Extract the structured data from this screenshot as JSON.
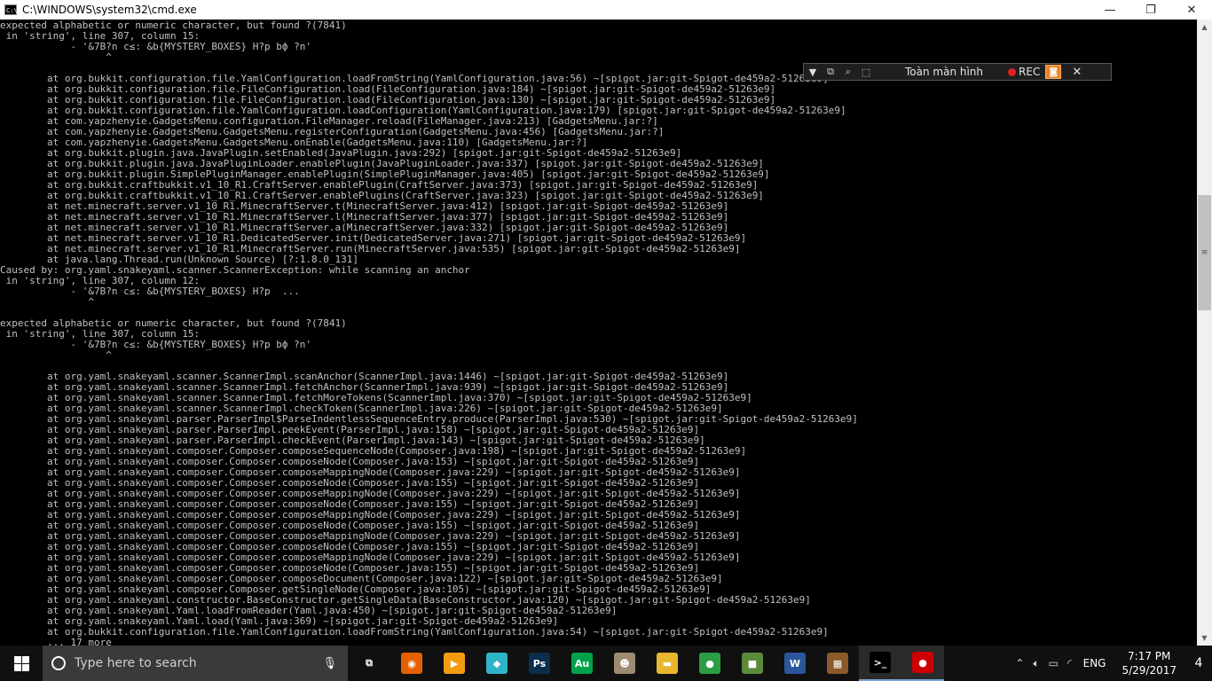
{
  "window": {
    "title": "C:\\WINDOWS\\system32\\cmd.exe",
    "icon": "cmd-icon",
    "controls": {
      "minimize": "—",
      "maximize": "❐",
      "close": "✕"
    }
  },
  "console": {
    "lines": [
      "expected alphabetic or numeric character, but found ?(7841)",
      " in 'string', line 307, column 15:",
      "            - '&7B?n c≤: &b{MYSTERY_BOXES} H?p bф ?n'",
      "                  ^",
      "",
      "        at org.bukkit.configuration.file.YamlConfiguration.loadFromString(YamlConfiguration.java:56) ~[spigot.jar:git-Spigot-de459a2-51263e9]",
      "        at org.bukkit.configuration.file.FileConfiguration.load(FileConfiguration.java:184) ~[spigot.jar:git-Spigot-de459a2-51263e9]",
      "        at org.bukkit.configuration.file.FileConfiguration.load(FileConfiguration.java:130) ~[spigot.jar:git-Spigot-de459a2-51263e9]",
      "        at org.bukkit.configuration.file.YamlConfiguration.loadConfiguration(YamlConfiguration.java:179) [spigot.jar:git-Spigot-de459a2-51263e9]",
      "        at com.yapzhenyie.GadgetsMenu.configuration.FileManager.reload(FileManager.java:213) [GadgetsMenu.jar:?]",
      "        at com.yapzhenyie.GadgetsMenu.GadgetsMenu.registerConfiguration(GadgetsMenu.java:456) [GadgetsMenu.jar:?]",
      "        at com.yapzhenyie.GadgetsMenu.GadgetsMenu.onEnable(GadgetsMenu.java:110) [GadgetsMenu.jar:?]",
      "        at org.bukkit.plugin.java.JavaPlugin.setEnabled(JavaPlugin.java:292) [spigot.jar:git-Spigot-de459a2-51263e9]",
      "        at org.bukkit.plugin.java.JavaPluginLoader.enablePlugin(JavaPluginLoader.java:337) [spigot.jar:git-Spigot-de459a2-51263e9]",
      "        at org.bukkit.plugin.SimplePluginManager.enablePlugin(SimplePluginManager.java:405) [spigot.jar:git-Spigot-de459a2-51263e9]",
      "        at org.bukkit.craftbukkit.v1_10_R1.CraftServer.enablePlugin(CraftServer.java:373) [spigot.jar:git-Spigot-de459a2-51263e9]",
      "        at org.bukkit.craftbukkit.v1_10_R1.CraftServer.enablePlugins(CraftServer.java:323) [spigot.jar:git-Spigot-de459a2-51263e9]",
      "        at net.minecraft.server.v1_10_R1.MinecraftServer.t(MinecraftServer.java:412) [spigot.jar:git-Spigot-de459a2-51263e9]",
      "        at net.minecraft.server.v1_10_R1.MinecraftServer.l(MinecraftServer.java:377) [spigot.jar:git-Spigot-de459a2-51263e9]",
      "        at net.minecraft.server.v1_10_R1.MinecraftServer.a(MinecraftServer.java:332) [spigot.jar:git-Spigot-de459a2-51263e9]",
      "        at net.minecraft.server.v1_10_R1.DedicatedServer.init(DedicatedServer.java:271) [spigot.jar:git-Spigot-de459a2-51263e9]",
      "        at net.minecraft.server.v1_10_R1.MinecraftServer.run(MinecraftServer.java:535) [spigot.jar:git-Spigot-de459a2-51263e9]",
      "        at java.lang.Thread.run(Unknown Source) [?:1.8.0_131]",
      "Caused by: org.yaml.snakeyaml.scanner.ScannerException: while scanning an anchor",
      " in 'string', line 307, column 12:",
      "            - '&7B?n c≤: &b{MYSTERY_BOXES} H?p  ...",
      "               ^",
      "",
      "expected alphabetic or numeric character, but found ?(7841)",
      " in 'string', line 307, column 15:",
      "            - '&7B?n c≤: &b{MYSTERY_BOXES} H?p bф ?n'",
      "                  ^",
      "",
      "        at org.yaml.snakeyaml.scanner.ScannerImpl.scanAnchor(ScannerImpl.java:1446) ~[spigot.jar:git-Spigot-de459a2-51263e9]",
      "        at org.yaml.snakeyaml.scanner.ScannerImpl.fetchAnchor(ScannerImpl.java:939) ~[spigot.jar:git-Spigot-de459a2-51263e9]",
      "        at org.yaml.snakeyaml.scanner.ScannerImpl.fetchMoreTokens(ScannerImpl.java:370) ~[spigot.jar:git-Spigot-de459a2-51263e9]",
      "        at org.yaml.snakeyaml.scanner.ScannerImpl.checkToken(ScannerImpl.java:226) ~[spigot.jar:git-Spigot-de459a2-51263e9]",
      "        at org.yaml.snakeyaml.parser.ParserImpl$ParseIndentlessSequenceEntry.produce(ParserImpl.java:530) ~[spigot.jar:git-Spigot-de459a2-51263e9]",
      "        at org.yaml.snakeyaml.parser.ParserImpl.peekEvent(ParserImpl.java:158) ~[spigot.jar:git-Spigot-de459a2-51263e9]",
      "        at org.yaml.snakeyaml.parser.ParserImpl.checkEvent(ParserImpl.java:143) ~[spigot.jar:git-Spigot-de459a2-51263e9]",
      "        at org.yaml.snakeyaml.composer.Composer.composeSequenceNode(Composer.java:198) ~[spigot.jar:git-Spigot-de459a2-51263e9]",
      "        at org.yaml.snakeyaml.composer.Composer.composeNode(Composer.java:153) ~[spigot.jar:git-Spigot-de459a2-51263e9]",
      "        at org.yaml.snakeyaml.composer.Composer.composeMappingNode(Composer.java:229) ~[spigot.jar:git-Spigot-de459a2-51263e9]",
      "        at org.yaml.snakeyaml.composer.Composer.composeNode(Composer.java:155) ~[spigot.jar:git-Spigot-de459a2-51263e9]",
      "        at org.yaml.snakeyaml.composer.Composer.composeMappingNode(Composer.java:229) ~[spigot.jar:git-Spigot-de459a2-51263e9]",
      "        at org.yaml.snakeyaml.composer.Composer.composeNode(Composer.java:155) ~[spigot.jar:git-Spigot-de459a2-51263e9]",
      "        at org.yaml.snakeyaml.composer.Composer.composeMappingNode(Composer.java:229) ~[spigot.jar:git-Spigot-de459a2-51263e9]",
      "        at org.yaml.snakeyaml.composer.Composer.composeNode(Composer.java:155) ~[spigot.jar:git-Spigot-de459a2-51263e9]",
      "        at org.yaml.snakeyaml.composer.Composer.composeMappingNode(Composer.java:229) ~[spigot.jar:git-Spigot-de459a2-51263e9]",
      "        at org.yaml.snakeyaml.composer.Composer.composeNode(Composer.java:155) ~[spigot.jar:git-Spigot-de459a2-51263e9]",
      "        at org.yaml.snakeyaml.composer.Composer.composeMappingNode(Composer.java:229) ~[spigot.jar:git-Spigot-de459a2-51263e9]",
      "        at org.yaml.snakeyaml.composer.Composer.composeNode(Composer.java:155) ~[spigot.jar:git-Spigot-de459a2-51263e9]",
      "        at org.yaml.snakeyaml.composer.Composer.composeDocument(Composer.java:122) ~[spigot.jar:git-Spigot-de459a2-51263e9]",
      "        at org.yaml.snakeyaml.composer.Composer.getSingleNode(Composer.java:105) ~[spigot.jar:git-Spigot-de459a2-51263e9]",
      "        at org.yaml.snakeyaml.constructor.BaseConstructor.getSingleData(BaseConstructor.java:120) ~[spigot.jar:git-Spigot-de459a2-51263e9]",
      "        at org.yaml.snakeyaml.Yaml.loadFromReader(Yaml.java:450) ~[spigot.jar:git-Spigot-de459a2-51263e9]",
      "        at org.yaml.snakeyaml.Yaml.load(Yaml.java:369) ~[spigot.jar:git-Spigot-de459a2-51263e9]",
      "        at org.bukkit.configuration.file.YamlConfiguration.loadFromString(YamlConfiguration.java:54) ~[spigot.jar:git-Spigot-de459a2-51263e9]",
      "        ... 17 more"
    ]
  },
  "recorder": {
    "label": "Toàn màn hình",
    "rec_label": "REC",
    "colors": {
      "rec_dot": "#e02020",
      "camera": "#e8832a"
    }
  },
  "taskbar": {
    "search_placeholder": "Type here to search",
    "apps": [
      {
        "name": "taskview",
        "glyph": "⧉",
        "color": "#101010"
      },
      {
        "name": "firefox",
        "glyph": "◉",
        "color": "#e66000"
      },
      {
        "name": "media-player",
        "glyph": "▶",
        "color": "#f39c12"
      },
      {
        "name": "app-cube",
        "glyph": "◆",
        "color": "#2fb3c9"
      },
      {
        "name": "photoshop",
        "glyph": "Ps",
        "color": "#0b2d4e"
      },
      {
        "name": "audition",
        "glyph": "Au",
        "color": "#00a34a"
      },
      {
        "name": "app-character",
        "glyph": "☻",
        "color": "#9c8b70"
      },
      {
        "name": "file-explorer",
        "glyph": "▬",
        "color": "#e8b730"
      },
      {
        "name": "chrome",
        "glyph": "●",
        "color": "#2a9d45"
      },
      {
        "name": "minecraft",
        "glyph": "■",
        "color": "#5b8a3a"
      },
      {
        "name": "word",
        "glyph": "W",
        "color": "#2b579a"
      },
      {
        "name": "app-chest",
        "glyph": "▦",
        "color": "#8a5a2b"
      },
      {
        "name": "cmd",
        "glyph": ">_",
        "color": "#000000",
        "active": true
      },
      {
        "name": "recorder",
        "glyph": "●",
        "color": "#cc0000",
        "active": true
      }
    ],
    "tray": {
      "language": "ENG",
      "time": "7:17 PM",
      "date": "5/29/2017",
      "notifications": "4"
    }
  }
}
